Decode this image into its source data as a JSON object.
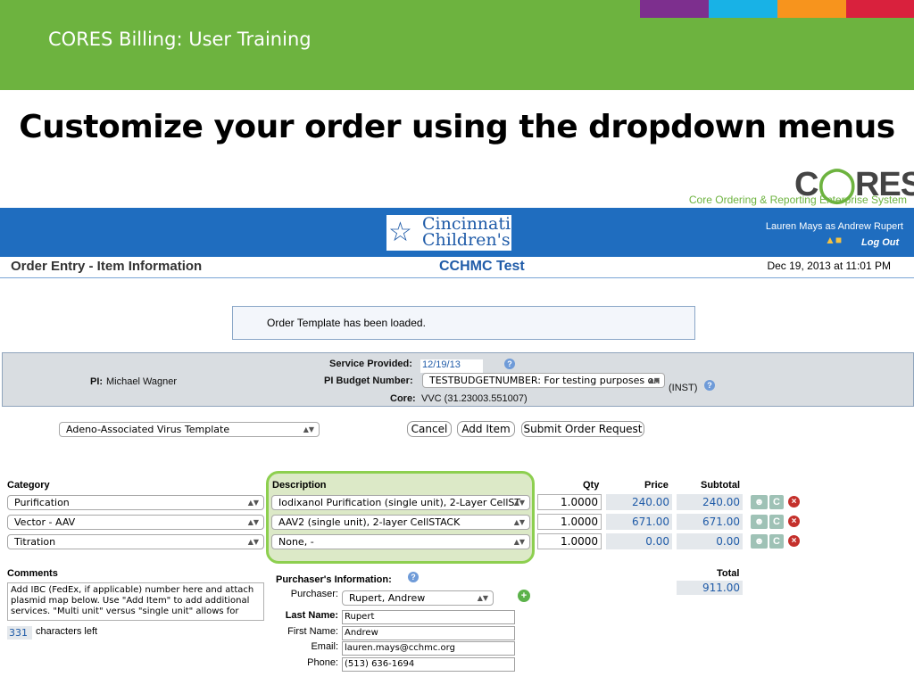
{
  "slide": {
    "title": "CORES Billing: User Training",
    "heading": "Customize your order using the dropdown menus",
    "colors": {
      "header_green": "#6db33f",
      "strip": [
        "#7d2f8e",
        "#18b2e6",
        "#f7941d",
        "#d9213d"
      ]
    }
  },
  "cores_logo": {
    "name": "CORES",
    "tagline": "Core Ordering & Reporting Enterprise System"
  },
  "app_header": {
    "hospital_logo": "Cincinnati Children's",
    "hospital_mark_icon": "child-figure-icon",
    "user": "Lauren Mays as Andrew Rupert",
    "logout": "Log Out",
    "page_title": "Order Entry - Item Information",
    "facility": "CCHMC Test",
    "datetime": "Dec 19, 2013 at 11:01 PM"
  },
  "notice": "Order Template has been loaded.",
  "info": {
    "pi_label": "PI:",
    "pi_name": "Michael Wagner",
    "service_label": "Service Provided:",
    "service_date": "12/19/13",
    "budget_label": "PI Budget Number:",
    "budget_value": "TESTBUDGETNUMBER: For testing purposes on",
    "budget_suffix": "(INST)",
    "core_label": "Core:",
    "core_value": "VVC (31.23003.551007)"
  },
  "template_select": "Adeno-Associated Virus Template",
  "buttons": {
    "cancel": "Cancel",
    "add_item": "Add Item",
    "submit": "Submit Order Request"
  },
  "grid": {
    "headers": {
      "category": "Category",
      "description": "Description",
      "qty": "Qty",
      "price": "Price",
      "subtotal": "Subtotal"
    },
    "rows": [
      {
        "category": "Purification",
        "description": "Iodixanol Purification (single unit), 2-Layer CellST",
        "qty": "1.0000",
        "price": "240.00",
        "subtotal": "240.00"
      },
      {
        "category": "Vector - AAV",
        "description": "AAV2 (single unit), 2-layer CellSTACK",
        "qty": "1.0000",
        "price": "671.00",
        "subtotal": "671.00"
      },
      {
        "category": "Titration",
        "description": "None, -",
        "qty": "1.0000",
        "price": "0.00",
        "subtotal": "0.00"
      }
    ],
    "total_label": "Total",
    "total_value": "911.00"
  },
  "comments": {
    "label": "Comments",
    "text": "Add IBC (FedEx, if applicable) number here and attach plasmid map below. Use \"Add Item\" to add additional services. \"Multi unit\" versus \"single unit\" allows for",
    "chars_left_count": "331",
    "chars_left_label": "characters left"
  },
  "purchaser": {
    "heading": "Purchaser's Information:",
    "purchaser_label": "Purchaser:",
    "purchaser_value": "Rupert, Andrew",
    "last_name_label": "Last Name:",
    "last_name": "Rupert",
    "first_name_label": "First Name:",
    "first_name": "Andrew",
    "email_label": "Email:",
    "email": "lauren.mays@cchmc.org",
    "phone_label": "Phone:",
    "phone": "(513) 636-1694"
  }
}
